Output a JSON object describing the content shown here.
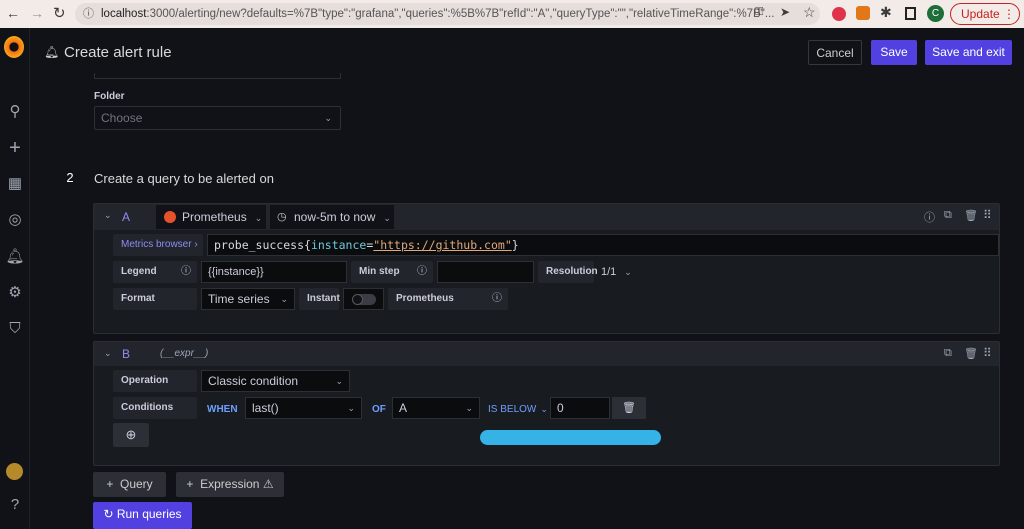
{
  "browser": {
    "url_host": "localhost",
    "url_rest": ":3000/alerting/new?defaults=%7B\"type\":\"grafana\",\"queries\":%5B%7B\"refId\":\"A\",\"queryType\":\"\",\"relativeTimeRange\":%7B\"...",
    "update_label": "Update",
    "profile_initial": "C"
  },
  "header": {
    "title": "Create alert rule",
    "cancel": "Cancel",
    "save": "Save",
    "save_exit": "Save and exit"
  },
  "folder": {
    "label": "Folder",
    "placeholder": "Choose"
  },
  "step": {
    "number": "2",
    "title": "Create a query to be alerted on"
  },
  "queryA": {
    "ref": "A",
    "datasource": "Prometheus",
    "time_range": "now-5m to now",
    "metrics_browser": "Metrics browser ›",
    "expr_metric": "probe_success{",
    "expr_label": "instance",
    "expr_eq": "=",
    "expr_value": "\"https://github.com\"",
    "expr_close": "}",
    "legend_label": "Legend",
    "legend_value": "{{instance}}",
    "minstep_label": "Min step",
    "minstep_value": "",
    "resolution_label": "Resolution",
    "resolution_value": "1/1",
    "format_label": "Format",
    "format_value": "Time series",
    "instant_label": "Instant",
    "instant_on": false,
    "prom_label": "Prometheus"
  },
  "queryB": {
    "ref": "B",
    "name": "(__expr__)",
    "operation_label": "Operation",
    "operation_value": "Classic condition",
    "conditions_label": "Conditions",
    "when": "WHEN",
    "func": "last()",
    "of": "OF",
    "query": "A",
    "evaluator": "IS BELOW",
    "threshold": "0"
  },
  "actions": {
    "query": "Query",
    "expression": "Expression",
    "run": "Run queries"
  }
}
